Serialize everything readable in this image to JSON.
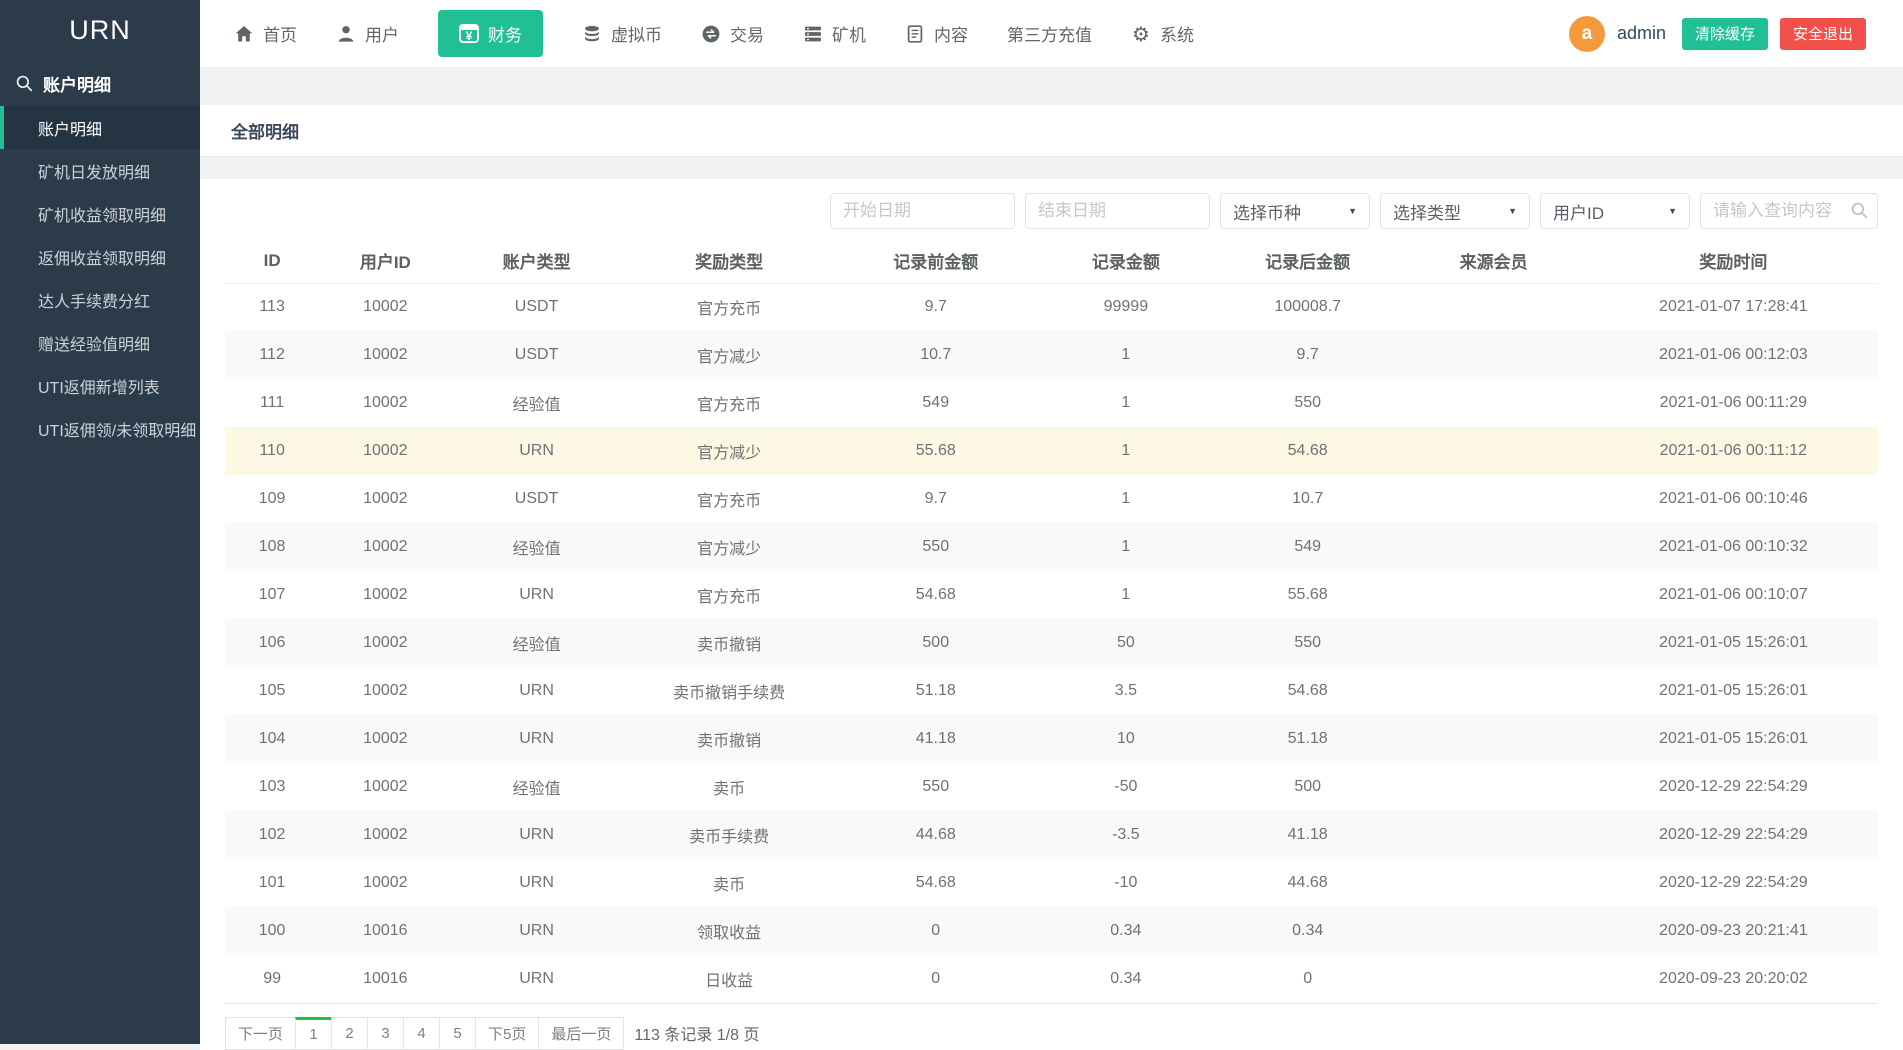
{
  "app": {
    "brand": "URN"
  },
  "topnav": {
    "items": [
      {
        "label": "首页",
        "icon": "home-icon",
        "active": false
      },
      {
        "label": "用户",
        "icon": "user-icon",
        "active": false
      },
      {
        "label": "财务",
        "icon": "yen-icon",
        "active": true
      },
      {
        "label": "虚拟币",
        "icon": "coins-icon",
        "active": false
      },
      {
        "label": "交易",
        "icon": "exchange-icon",
        "active": false
      },
      {
        "label": "矿机",
        "icon": "server-icon",
        "active": false
      },
      {
        "label": "内容",
        "icon": "document-icon",
        "active": false
      },
      {
        "label": "第三方充值",
        "icon": null,
        "active": false
      },
      {
        "label": "系统",
        "icon": "gear-icon",
        "active": false
      }
    ],
    "user": {
      "avatar_letter": "a",
      "name": "admin"
    },
    "clear_cache_label": "清除缓存",
    "logout_label": "安全退出"
  },
  "sidebar": {
    "section_label": "账户明细",
    "items": [
      {
        "label": "账户明细",
        "active": true
      },
      {
        "label": "矿机日发放明细",
        "active": false
      },
      {
        "label": "矿机收益领取明细",
        "active": false
      },
      {
        "label": "返佣收益领取明细",
        "active": false
      },
      {
        "label": "达人手续费分红",
        "active": false
      },
      {
        "label": "赠送经验值明细",
        "active": false
      },
      {
        "label": "UTI返佣新增列表",
        "active": false
      },
      {
        "label": "UTI返佣领/未领取明细",
        "active": false
      }
    ]
  },
  "page": {
    "tab_title": "全部明细"
  },
  "filters": {
    "start_date_placeholder": "开始日期",
    "end_date_placeholder": "结束日期",
    "coin_select_value": "选择币种",
    "type_select_value": "选择类型",
    "userid_select_value": "用户ID",
    "search_placeholder": "请输入查询内容"
  },
  "table": {
    "headers": [
      "ID",
      "用户ID",
      "账户类型",
      "奖励类型",
      "记录前金额",
      "记录金额",
      "记录后金额",
      "来源会员",
      "奖励时间"
    ],
    "col_widths": [
      "5.7%",
      "8%",
      "10.3%",
      "13%",
      "12%",
      "11%",
      "11%",
      "11.5%",
      "17.5%"
    ],
    "highlighted_row_id": "110",
    "rows": [
      [
        "113",
        "10002",
        "USDT",
        "官方充币",
        "9.7",
        "99999",
        "100008.7",
        "",
        "2021-01-07 17:28:41"
      ],
      [
        "112",
        "10002",
        "USDT",
        "官方减少",
        "10.7",
        "1",
        "9.7",
        "",
        "2021-01-06 00:12:03"
      ],
      [
        "111",
        "10002",
        "经验值",
        "官方充币",
        "549",
        "1",
        "550",
        "",
        "2021-01-06 00:11:29"
      ],
      [
        "110",
        "10002",
        "URN",
        "官方减少",
        "55.68",
        "1",
        "54.68",
        "",
        "2021-01-06 00:11:12"
      ],
      [
        "109",
        "10002",
        "USDT",
        "官方充币",
        "9.7",
        "1",
        "10.7",
        "",
        "2021-01-06 00:10:46"
      ],
      [
        "108",
        "10002",
        "经验值",
        "官方减少",
        "550",
        "1",
        "549",
        "",
        "2021-01-06 00:10:32"
      ],
      [
        "107",
        "10002",
        "URN",
        "官方充币",
        "54.68",
        "1",
        "55.68",
        "",
        "2021-01-06 00:10:07"
      ],
      [
        "106",
        "10002",
        "经验值",
        "卖币撤销",
        "500",
        "50",
        "550",
        "",
        "2021-01-05 15:26:01"
      ],
      [
        "105",
        "10002",
        "URN",
        "卖币撤销手续费",
        "51.18",
        "3.5",
        "54.68",
        "",
        "2021-01-05 15:26:01"
      ],
      [
        "104",
        "10002",
        "URN",
        "卖币撤销",
        "41.18",
        "10",
        "51.18",
        "",
        "2021-01-05 15:26:01"
      ],
      [
        "103",
        "10002",
        "经验值",
        "卖币",
        "550",
        "-50",
        "500",
        "",
        "2020-12-29 22:54:29"
      ],
      [
        "102",
        "10002",
        "URN",
        "卖币手续费",
        "44.68",
        "-3.5",
        "41.18",
        "",
        "2020-12-29 22:54:29"
      ],
      [
        "101",
        "10002",
        "URN",
        "卖币",
        "54.68",
        "-10",
        "44.68",
        "",
        "2020-12-29 22:54:29"
      ],
      [
        "100",
        "10016",
        "URN",
        "领取收益",
        "0",
        "0.34",
        "0.34",
        "",
        "2020-09-23 20:21:41"
      ],
      [
        "99",
        "10016",
        "URN",
        "日收益",
        "0",
        "0.34",
        "0",
        "",
        "2020-09-23 20:20:02"
      ]
    ]
  },
  "pagination": {
    "items": [
      "下一页",
      "1",
      "2",
      "3",
      "4",
      "5",
      "下5页",
      "最后一页"
    ],
    "active_item": "1",
    "summary": "113 条记录 1/8 页"
  },
  "colors": {
    "brand_teal": "#20bf96",
    "logout_red": "#f2504b",
    "avatar_orange": "#f59a3c",
    "sidebar_bg": "#2c3b4a",
    "sidebar_active_bg": "#253442",
    "pagination_active_green": "#22c13d",
    "row_highlight": "#fcf8e3"
  }
}
